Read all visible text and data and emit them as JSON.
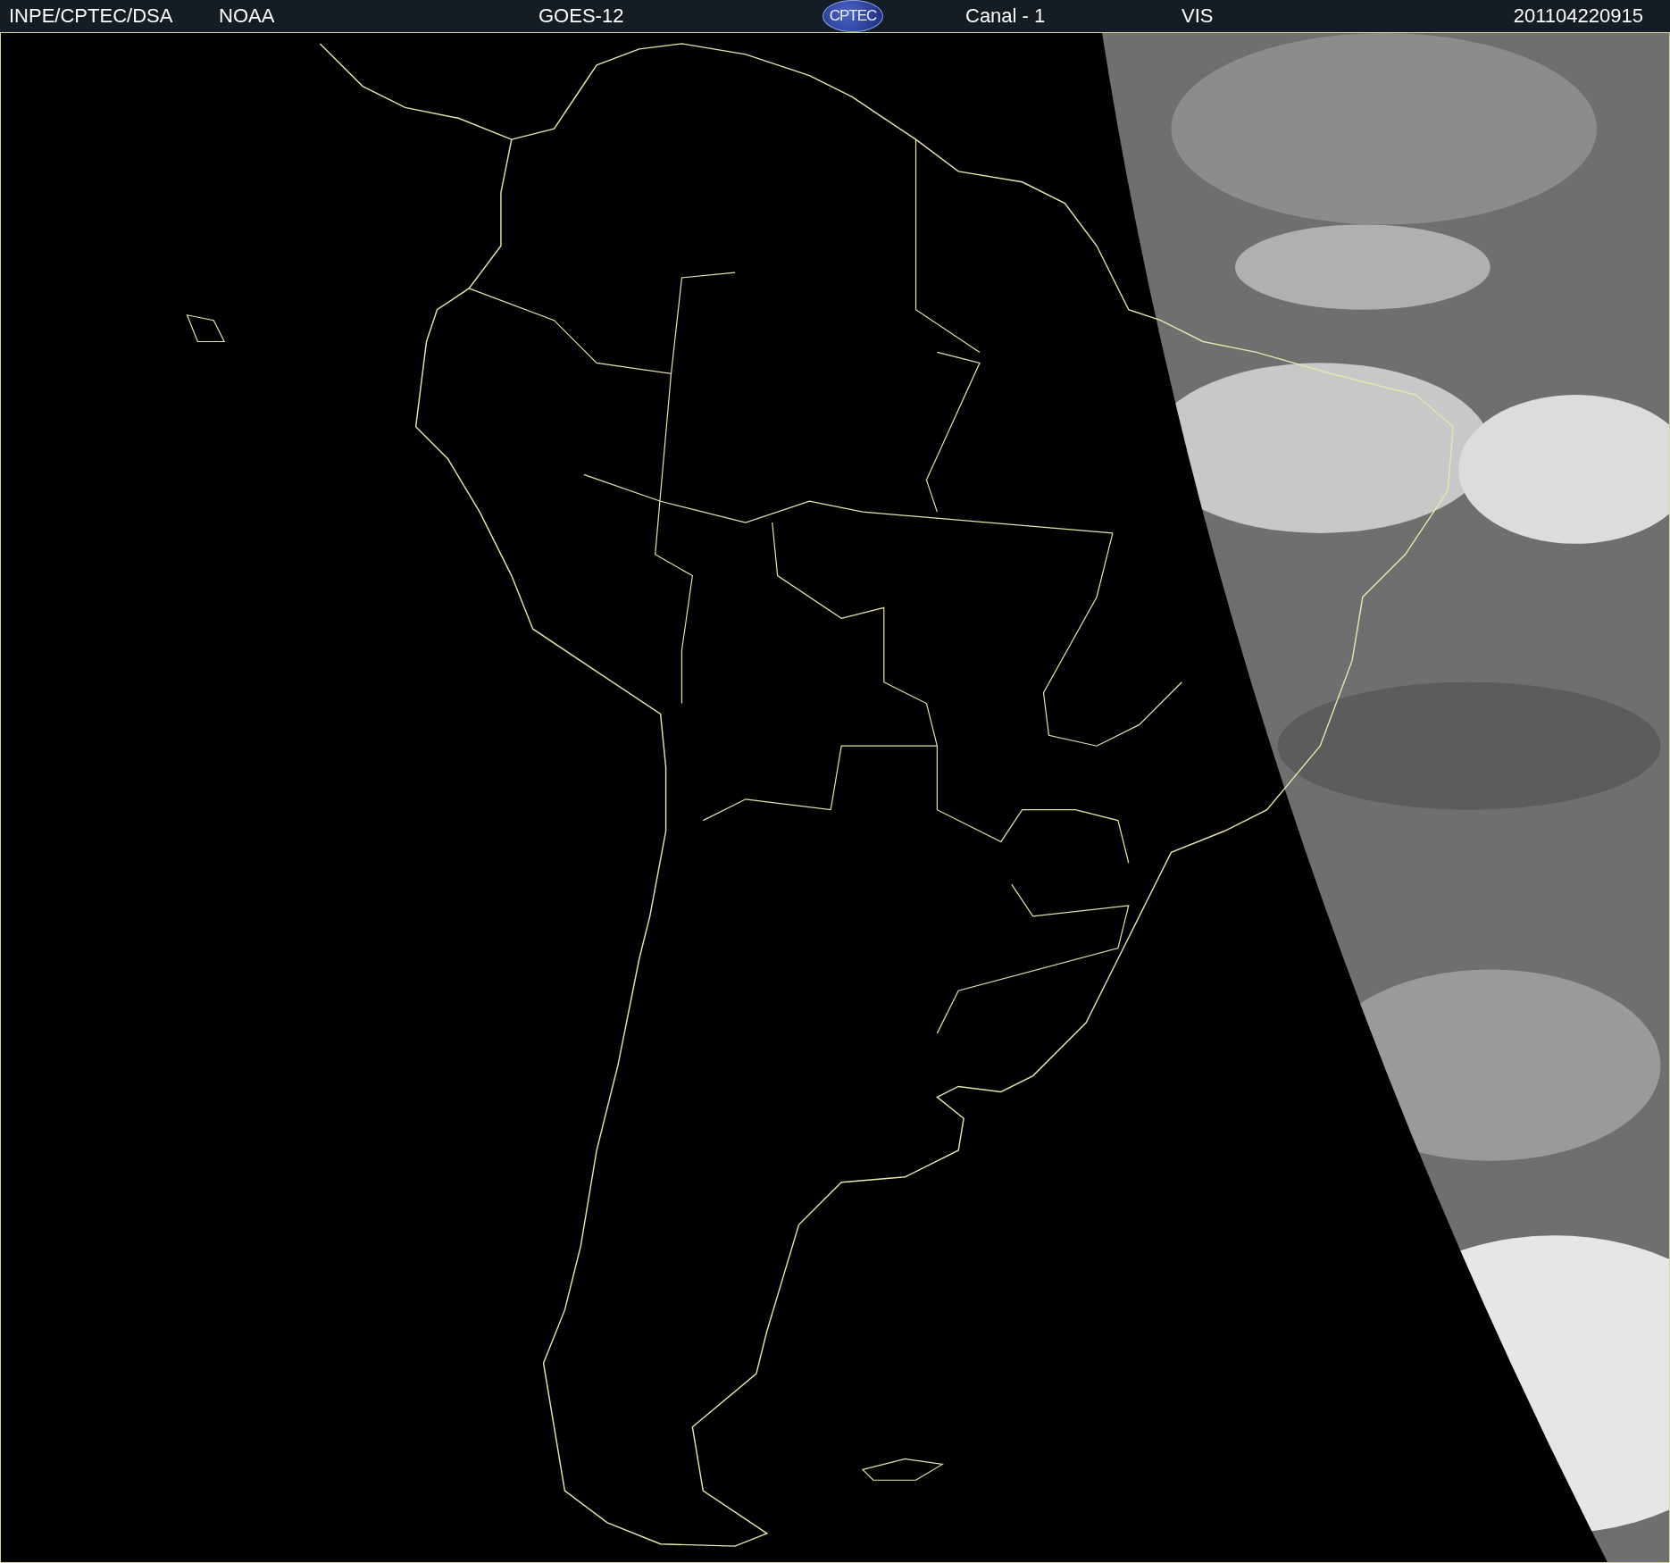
{
  "header": {
    "source": "INPE/CPTEC/DSA",
    "agency": "NOAA",
    "satellite": "GOES-12",
    "logo": "CPTEC",
    "channel": "Canal - 1",
    "band": "VIS",
    "timestamp": "201104220915"
  }
}
